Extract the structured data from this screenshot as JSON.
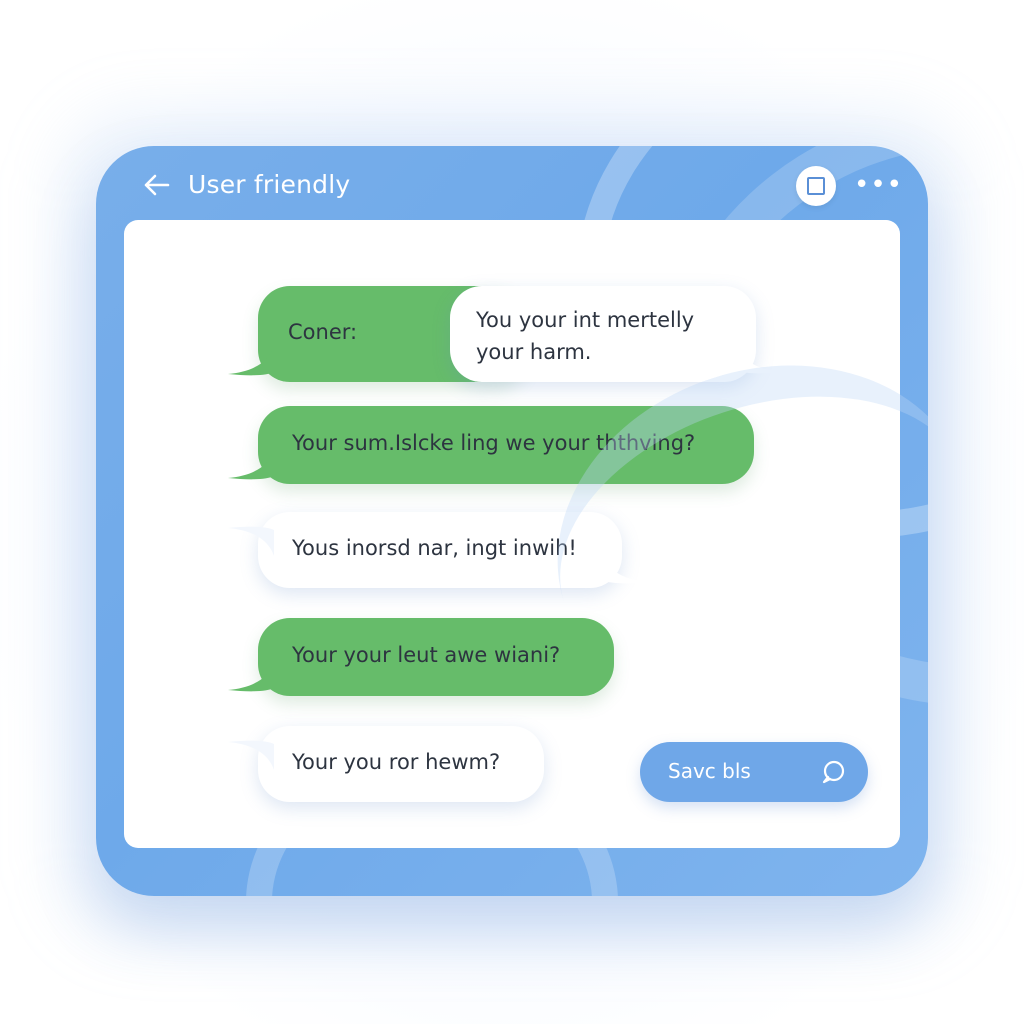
{
  "header": {
    "title": "User friendly",
    "back_icon": "arrow-left-icon",
    "window_icon": "square-icon",
    "more_icon": "more-horizontal-icon",
    "more_glyph": "•••"
  },
  "messages": [
    {
      "side": "left",
      "color": "green",
      "text": "Coner:"
    },
    {
      "side": "right",
      "color": "white",
      "text_line1": "You your int mertelly",
      "text_line2": "your harm."
    },
    {
      "side": "left",
      "color": "green",
      "text": "Your sum.Islcke ling we your ththving?"
    },
    {
      "side": "left",
      "color": "white",
      "text": "Yous inorsd nar, ingt inwih!"
    },
    {
      "side": "left",
      "color": "green",
      "text": "Your your leut awe wiani?"
    },
    {
      "side": "left",
      "color": "white",
      "text": "Your you ror hewm?"
    }
  ],
  "action_button": {
    "label": "Savc bls",
    "icon": "chat-bubble-icon"
  },
  "colors": {
    "frame": "#6ea9ea",
    "green_bubble": "#66bc6a",
    "white_bubble": "#ffffff",
    "text": "#2d3440",
    "button": "#6fa7e8"
  }
}
